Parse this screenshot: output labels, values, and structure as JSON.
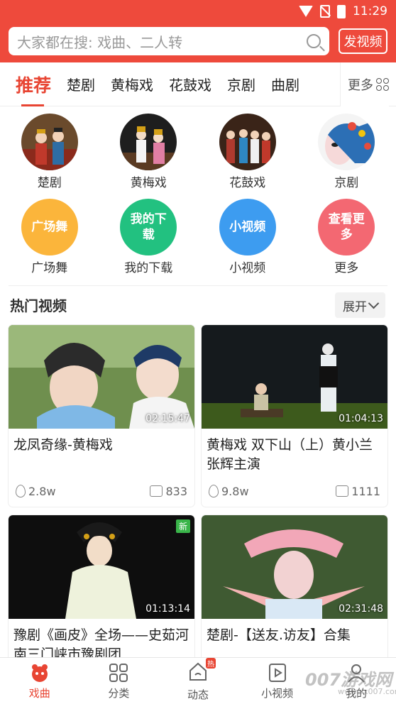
{
  "status_bar": {
    "time": "11:29"
  },
  "search": {
    "placeholder": "大家都在搜: 戏曲、二人转",
    "upload_label": "发视频"
  },
  "tabs": [
    {
      "label": "推荐",
      "active": true
    },
    {
      "label": "楚剧"
    },
    {
      "label": "黄梅戏"
    },
    {
      "label": "花鼓戏"
    },
    {
      "label": "京剧"
    },
    {
      "label": "曲剧"
    }
  ],
  "tab_more_label": "更多",
  "categories": [
    {
      "label": "楚剧",
      "icon": "opera-photo"
    },
    {
      "label": "黄梅戏",
      "icon": "opera-photo"
    },
    {
      "label": "花鼓戏",
      "icon": "opera-photo"
    },
    {
      "label": "京剧",
      "icon": "opera-mask-photo"
    }
  ],
  "quick_links": [
    {
      "icon_text": "广场舞",
      "label": "广场舞",
      "color": "#fbb53b"
    },
    {
      "icon_text": "我的下载",
      "label": "我的下载",
      "color": "#22c180"
    },
    {
      "icon_text": "小视频",
      "label": "小视频",
      "color": "#3d9cf0"
    },
    {
      "icon_text": "查看更多",
      "label": "更多",
      "color": "#f36872"
    }
  ],
  "hot_section": {
    "title": "热门视频",
    "expand_label": "展开"
  },
  "videos": [
    {
      "title": "龙凤奇缘-黄梅戏",
      "duration": "02:15:47",
      "views": "2.8w",
      "likes": "833",
      "new_badge": ""
    },
    {
      "title": "黄梅戏 双下山（上）黄小兰 张辉主演",
      "duration": "01:04:13",
      "views": "9.8w",
      "likes": "1111",
      "new_badge": ""
    },
    {
      "title": "豫剧《画皮》全场——史茹河南三门峡市豫剧团",
      "duration": "01:13:14",
      "views": "",
      "likes": "",
      "new_badge": "新"
    },
    {
      "title": "楚剧-【送友.访友】合集",
      "duration": "02:31:48",
      "views": "",
      "likes": "",
      "new_badge": ""
    }
  ],
  "bottom_nav": [
    {
      "label": "戏曲",
      "active": true,
      "icon": "opera-icon"
    },
    {
      "label": "分类",
      "icon": "category-icon"
    },
    {
      "label": "动态",
      "icon": "home-icon",
      "badge": "热"
    },
    {
      "label": "小视频",
      "icon": "play-icon"
    },
    {
      "label": "我的",
      "icon": "user-icon"
    }
  ],
  "watermark": {
    "text": "007游戏网",
    "sub": "www.yx007.com"
  }
}
